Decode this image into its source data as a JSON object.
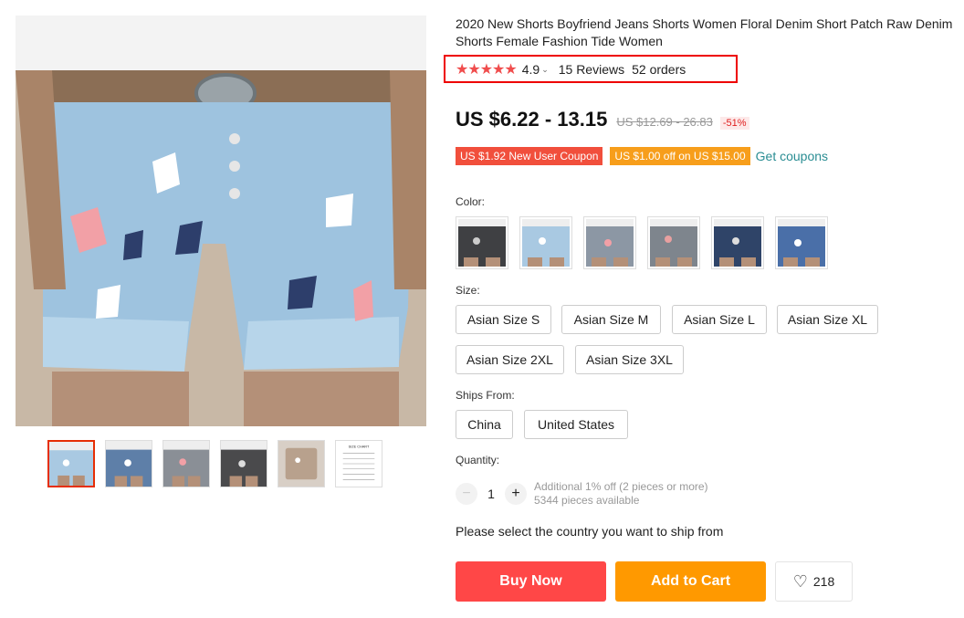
{
  "product": {
    "title": "2020 New Shorts Boyfriend Jeans Shorts Women Floral Denim Short Patch Raw Denim Shorts Female Fashion Tide Women",
    "stars": "★★★★★",
    "rating": "4.9",
    "reviews": "15 Reviews",
    "orders": "52 orders"
  },
  "price": {
    "current": "US $6.22 - 13.15",
    "original": "US $12.69 - 26.83",
    "discount": "-51%"
  },
  "coupons": {
    "new_user": "US $1.92 New User Coupon",
    "threshold": "US $1.00 off on US $15.00",
    "get_link": "Get coupons"
  },
  "color": {
    "label": "Color:",
    "swatch_count": 6
  },
  "size": {
    "label": "Size:",
    "options": [
      "Asian Size S",
      "Asian Size M",
      "Asian Size L",
      "Asian Size XL",
      "Asian Size 2XL",
      "Asian Size 3XL"
    ]
  },
  "ships_from": {
    "label": "Ships From:",
    "options": [
      "China",
      "United States"
    ]
  },
  "quantity": {
    "label": "Quantity:",
    "minus": "−",
    "plus": "+",
    "value": "1",
    "discount_note": "Additional 1% off (2 pieces or more)",
    "available": "5344 pieces available"
  },
  "ship_note": "Please select the country you want to ship from",
  "actions": {
    "buy_now": "Buy Now",
    "add_to_cart": "Add to Cart",
    "wishlist_count": "218"
  },
  "thumbnails": {
    "size_chart_label": "SIZE CHART"
  },
  "icons": {
    "rating_dropdown": "chevron-down-icon",
    "wishlist": "heart-icon",
    "minus": "minus-icon",
    "plus": "plus-icon"
  },
  "colors": {
    "accent_red": "#ff4747",
    "accent_orange": "#ff9900",
    "star_red": "#f04d4d",
    "link_teal": "#2a8d93"
  }
}
